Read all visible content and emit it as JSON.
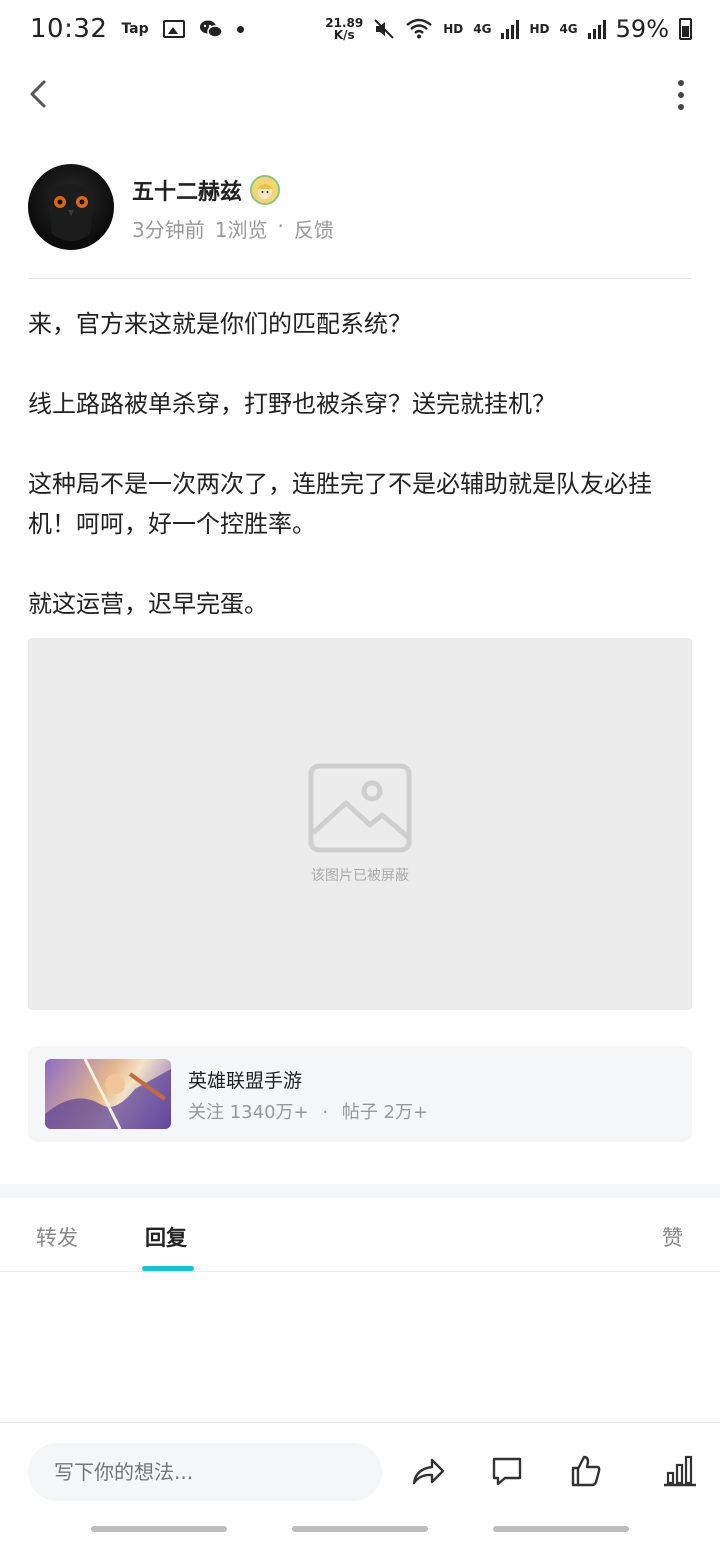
{
  "status_bar": {
    "time": "10:32",
    "tap_label": "Tap",
    "net_speed_value": "21.89",
    "net_speed_unit": "K/s",
    "hd1": "HD",
    "lte1": "4G",
    "hd2": "HD",
    "lte2": "4G",
    "battery": "59%"
  },
  "nav": {
    "back_icon": "chevron-left-icon",
    "more_icon": "more-vertical-icon"
  },
  "author": {
    "name": "五十二赫兹",
    "time_ago": "3分钟前",
    "views": "1浏览",
    "separator": "·",
    "feedback": "反馈"
  },
  "post": {
    "paragraphs": [
      "来，官方来这就是你们的匹配系统？",
      "线上路路被单杀穿，打野也被杀穿？送完就挂机？",
      "这种局不是一次两次了，连胜完了不是必辅助就是队友必挂机！呵呵，好一个控胜率。",
      "就这运营，迟早完蛋。"
    ],
    "blocked_image_label": "该图片已被屏蔽"
  },
  "game": {
    "name": "英雄联盟手游",
    "followers": "关注 1340万+",
    "separator": "·",
    "posts": "帖子 2万+"
  },
  "tabs": {
    "repost": "转发",
    "reply": "回复",
    "like": "赞"
  },
  "bottom_bar": {
    "input_placeholder": "写下你的想法..."
  },
  "colors": {
    "accent": "#15c5ce",
    "muted_text": "#999999",
    "card_bg": "#f5f6f8",
    "blocked_bg": "#ececec"
  }
}
